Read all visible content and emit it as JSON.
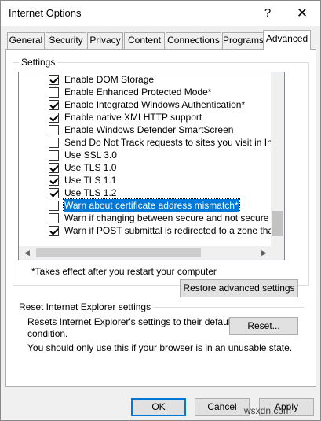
{
  "window": {
    "title": "Internet Options",
    "help_glyph": "?",
    "close_glyph": "✕"
  },
  "tabs": [
    {
      "label": "General"
    },
    {
      "label": "Security"
    },
    {
      "label": "Privacy"
    },
    {
      "label": "Content"
    },
    {
      "label": "Connections"
    },
    {
      "label": "Programs"
    },
    {
      "label": "Advanced",
      "active": true
    }
  ],
  "settings": {
    "legend": "Settings",
    "items": [
      {
        "label": "Enable DOM Storage",
        "checked": true
      },
      {
        "label": "Enable Enhanced Protected Mode*",
        "checked": false
      },
      {
        "label": "Enable Integrated Windows Authentication*",
        "checked": true
      },
      {
        "label": "Enable native XMLHTTP support",
        "checked": true
      },
      {
        "label": "Enable Windows Defender SmartScreen",
        "checked": false
      },
      {
        "label": "Send Do Not Track requests to sites you visit in Internet E",
        "checked": false
      },
      {
        "label": "Use SSL 3.0",
        "checked": false
      },
      {
        "label": "Use TLS 1.0",
        "checked": true
      },
      {
        "label": "Use TLS 1.1",
        "checked": true
      },
      {
        "label": "Use TLS 1.2",
        "checked": true
      },
      {
        "label": "Warn about certificate address mismatch*",
        "checked": false,
        "selected": true
      },
      {
        "label": "Warn if changing between secure and not secure mode",
        "checked": false
      },
      {
        "label": "Warn if POST submittal is redirected to a zone that does n",
        "checked": true
      }
    ],
    "note": "*Takes effect after you restart your computer",
    "restore_label": "Restore advanced settings"
  },
  "reset": {
    "legend": "Reset Internet Explorer settings",
    "description_line1": "Resets Internet Explorer's settings to their default",
    "description_line2": "condition.",
    "reset_label": "Reset...",
    "warning": "You should only use this if your browser is in an unusable state."
  },
  "footer": {
    "ok_label": "OK",
    "cancel_label": "Cancel",
    "apply_label": "Apply",
    "watermark": "wsxdn.com"
  },
  "colors": {
    "selection": "#0078d7",
    "dialog_bg": "#f0f0f0"
  }
}
